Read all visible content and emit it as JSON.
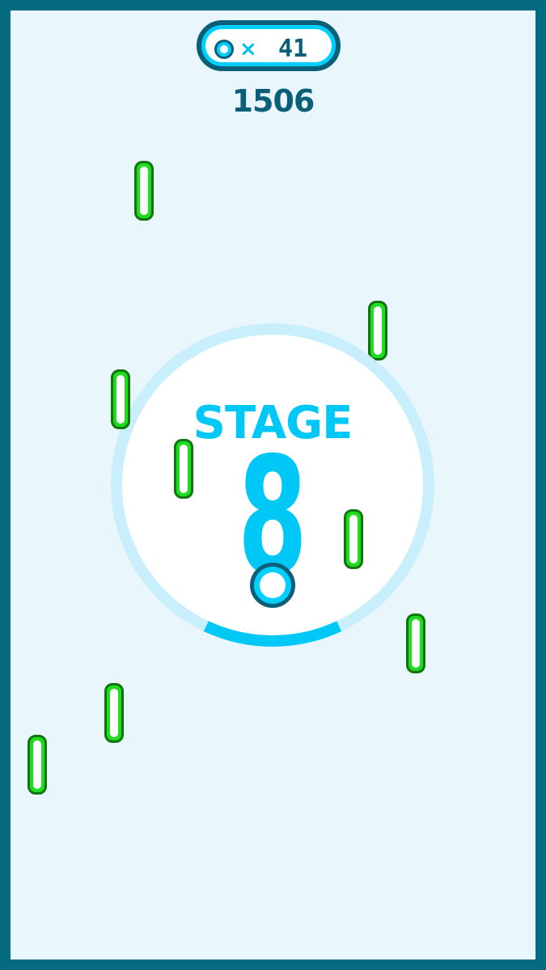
{
  "hud": {
    "ball_icon": "ball-icon",
    "times_symbol": "×",
    "balls_count": "41",
    "score": "1506"
  },
  "stage": {
    "label": "STAGE",
    "number": "8",
    "progress": 0.14
  },
  "colors": {
    "border": "#046b80",
    "background": "#e9f7fd",
    "accent": "#00c8f6",
    "dark": "#0b5f78",
    "peg_green": "#1fdc1f",
    "peg_outline": "#107510"
  },
  "pegs_count": 8
}
